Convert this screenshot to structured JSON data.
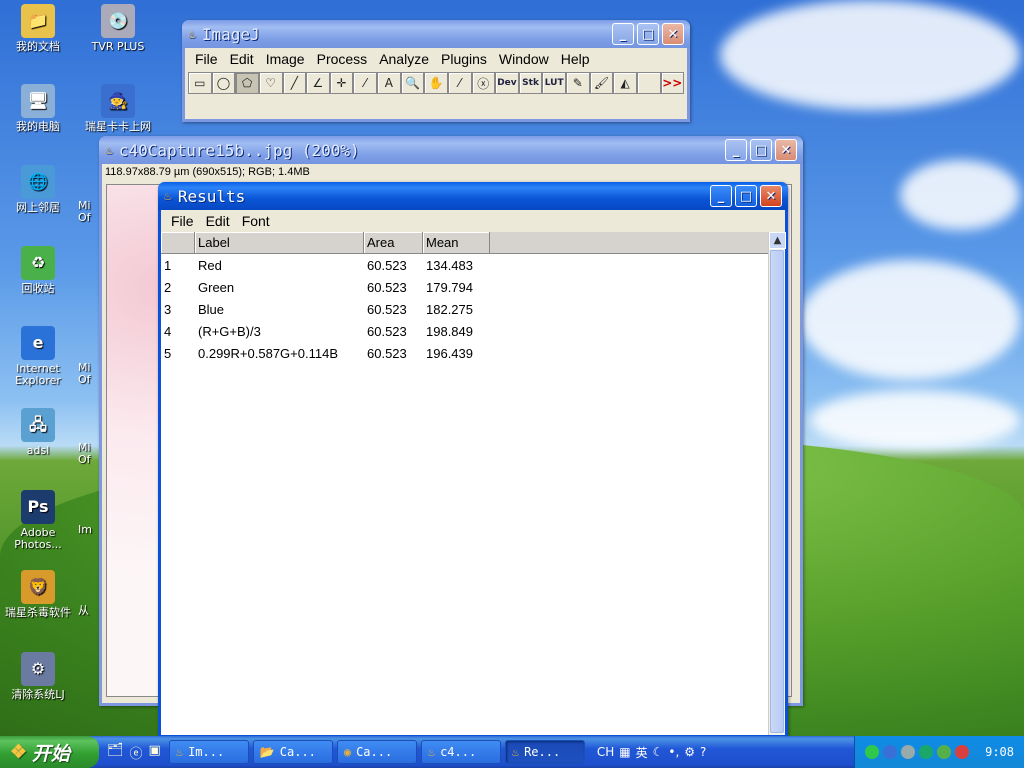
{
  "desktop": {
    "icons": [
      {
        "label": "我的文档",
        "glyph": "📁"
      },
      {
        "label": "TVR PLUS",
        "glyph": "💿"
      },
      {
        "label": "我的电脑",
        "glyph": "🖥"
      },
      {
        "label": "瑞星卡卡上网",
        "glyph": "🧙"
      },
      {
        "label": "网上邻居",
        "glyph": "🌐"
      },
      {
        "label": "Mi Of",
        "glyph": ""
      },
      {
        "label": "回收站",
        "glyph": "♻"
      },
      {
        "label": "Internet Explorer",
        "glyph": "e"
      },
      {
        "label": "Mi Of",
        "glyph": ""
      },
      {
        "label": "adsl",
        "glyph": "🖧"
      },
      {
        "label": "Mi Of",
        "glyph": ""
      },
      {
        "label": "Adobe Photos...",
        "glyph": "Ps"
      },
      {
        "label": "Im",
        "glyph": ""
      },
      {
        "label": "瑞星杀毒软件",
        "glyph": "🦁"
      },
      {
        "label": "从",
        "glyph": ""
      },
      {
        "label": "清除系统LJ",
        "glyph": "⚙"
      }
    ]
  },
  "imagej": {
    "title": "ImageJ",
    "menu": [
      "File",
      "Edit",
      "Image",
      "Process",
      "Analyze",
      "Plugins",
      "Window",
      "Help"
    ],
    "tools": [
      {
        "name": "rectangle-tool",
        "glyph": "▭"
      },
      {
        "name": "oval-tool",
        "glyph": "◯"
      },
      {
        "name": "polygon-tool",
        "glyph": "⬠"
      },
      {
        "name": "freehand-tool",
        "glyph": "♡"
      },
      {
        "name": "line-tool",
        "glyph": "╱"
      },
      {
        "name": "angle-tool",
        "glyph": "∠"
      },
      {
        "name": "point-tool",
        "glyph": "✛"
      },
      {
        "name": "wand-tool",
        "glyph": "⁄"
      },
      {
        "name": "text-tool",
        "glyph": "A"
      },
      {
        "name": "magnifier-tool",
        "glyph": "🔍"
      },
      {
        "name": "hand-tool",
        "glyph": "✋"
      },
      {
        "name": "dropper-tool",
        "glyph": "⁄"
      },
      {
        "name": "erase-tool",
        "glyph": "ⓧ"
      },
      {
        "name": "dev-tool",
        "glyph": "Dev"
      },
      {
        "name": "stk-tool",
        "glyph": "Stk"
      },
      {
        "name": "lut-tool",
        "glyph": "LUT"
      },
      {
        "name": "pencil-tool",
        "glyph": "✎"
      },
      {
        "name": "brush-tool",
        "glyph": "🖌"
      },
      {
        "name": "flood-fill-tool",
        "glyph": "◭"
      },
      {
        "name": "blank-tool",
        "glyph": ""
      },
      {
        "name": "more-tools",
        "glyph": ">>"
      }
    ]
  },
  "image_window": {
    "title": "c40Capture15b..jpg (200%)",
    "info": "118.97x88.79 µm (690x515); RGB; 1.4MB"
  },
  "results": {
    "title": "Results",
    "menu": [
      "File",
      "Edit",
      "Font"
    ],
    "columns": [
      "",
      "Label",
      "Area",
      "Mean"
    ],
    "rows": [
      [
        "1",
        "Red",
        "60.523",
        "134.483"
      ],
      [
        "2",
        "Green",
        "60.523",
        "179.794"
      ],
      [
        "3",
        "Blue",
        "60.523",
        "182.275"
      ],
      [
        "4",
        "(R+G+B)/3",
        "60.523",
        "198.849"
      ],
      [
        "5",
        "0.299R+0.587G+0.114B",
        "60.523",
        "196.439"
      ]
    ]
  },
  "window_buttons": {
    "minimize": "_",
    "maximize": "□",
    "close": "✕"
  },
  "taskbar": {
    "start_label": "开始",
    "tasks": [
      {
        "label": "Im...",
        "glyph": "♨"
      },
      {
        "label": "Ca...",
        "glyph": "📂"
      },
      {
        "label": "Ca...",
        "glyph": "◉"
      },
      {
        "label": "c4...",
        "glyph": "♨"
      },
      {
        "label": "Re...",
        "glyph": "♨"
      }
    ],
    "lang": "CH",
    "ime": "英",
    "clock": "9:08"
  }
}
